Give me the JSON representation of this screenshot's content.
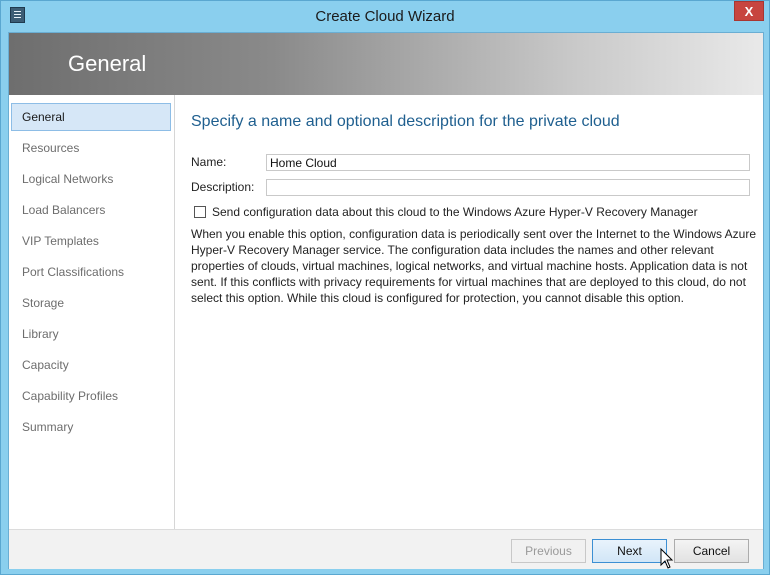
{
  "window": {
    "title": "Create Cloud Wizard",
    "close_label": "X",
    "icon": "app-icon"
  },
  "header": {
    "title": "General"
  },
  "nav": {
    "items": [
      {
        "label": "General",
        "active": true
      },
      {
        "label": "Resources"
      },
      {
        "label": "Logical Networks"
      },
      {
        "label": "Load Balancers"
      },
      {
        "label": "VIP Templates"
      },
      {
        "label": "Port Classifications"
      },
      {
        "label": "Storage"
      },
      {
        "label": "Library"
      },
      {
        "label": "Capacity"
      },
      {
        "label": "Capability Profiles"
      },
      {
        "label": "Summary"
      }
    ]
  },
  "main": {
    "heading": "Specify a name and optional description for the private cloud",
    "name_label": "Name:",
    "name_value": "Home Cloud",
    "description_label": "Description:",
    "description_value": "",
    "checkbox_label": "Send configuration data about this cloud to the Windows Azure Hyper-V Recovery Manager",
    "checkbox_checked": false,
    "info": "When you enable this option, configuration data is periodically sent over the Internet to the Windows Azure Hyper-V Recovery Manager service. The configuration data includes the names and other relevant properties of clouds, virtual machines, logical networks, and virtual machine hosts. Application data is not sent. If this conflicts with privacy requirements for virtual machines that are deployed to this cloud, do not select this option. While this cloud is configured for protection, you cannot disable this option."
  },
  "footer": {
    "previous_label": "Previous",
    "next_label": "Next",
    "cancel_label": "Cancel"
  },
  "colors": {
    "window_frame": "#8acfee",
    "heading": "#1f5f8f",
    "close": "#c7453f"
  }
}
